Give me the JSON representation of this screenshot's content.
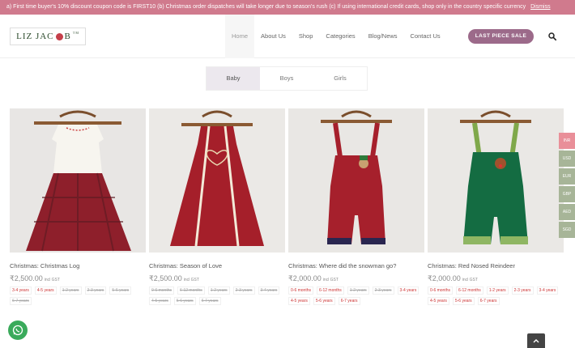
{
  "notice": {
    "text": "a) First time buyer's 10% discount coupon code is FIRST10 (b) Christmas order dispatches will take longer due to season's rush (c) If using international credit cards, shop only in the country specific currency",
    "dismiss": "Dismiss"
  },
  "logo": {
    "left": "LIZ JAC",
    "right": "B",
    "tm": "TM"
  },
  "nav": [
    "Home",
    "About Us",
    "Shop",
    "Categories",
    "Blog/News",
    "Contact Us"
  ],
  "sale_button": "LAST PIECE SALE",
  "tabs": [
    "Baby",
    "Boys",
    "Girls"
  ],
  "products": [
    {
      "title": "Christmas: Christmas Log",
      "price": "₹2,500.00",
      "gst": "incl GST",
      "sizes": [
        {
          "label": "3-4 years",
          "available": true
        },
        {
          "label": "4-5 years",
          "available": true
        },
        {
          "label": "1-2 years",
          "available": false
        },
        {
          "label": "2-3 years",
          "available": false
        },
        {
          "label": "5-6 years",
          "available": false
        },
        {
          "label": "6-7 years",
          "available": false
        }
      ]
    },
    {
      "title": "Christmas: Season of Love",
      "price": "₹2,500.00",
      "gst": "incl GST",
      "sizes": [
        {
          "label": "0-6 months",
          "available": false
        },
        {
          "label": "6-12 months",
          "available": false
        },
        {
          "label": "1-2 years",
          "available": false
        },
        {
          "label": "2-3 years",
          "available": false
        },
        {
          "label": "3-4 years",
          "available": false
        },
        {
          "label": "4-5 years",
          "available": false
        },
        {
          "label": "5-6 years",
          "available": false
        },
        {
          "label": "6-7 years",
          "available": false
        }
      ]
    },
    {
      "title": "Christmas: Where did the snowman go?",
      "price": "₹2,000.00",
      "gst": "incl GST",
      "sizes": [
        {
          "label": "0-6 months",
          "available": true
        },
        {
          "label": "6-12 months",
          "available": true
        },
        {
          "label": "1-2 years",
          "available": false
        },
        {
          "label": "2-3 years",
          "available": false
        },
        {
          "label": "3-4 years",
          "available": true
        },
        {
          "label": "4-5 years",
          "available": true
        },
        {
          "label": "5-6 years",
          "available": true
        },
        {
          "label": "6-7 years",
          "available": true
        }
      ]
    },
    {
      "title": "Christmas: Red Nosed Reindeer",
      "price": "₹2,000.00",
      "gst": "incl GST",
      "sizes": [
        {
          "label": "0-6 months",
          "available": true
        },
        {
          "label": "6-12 months",
          "available": true
        },
        {
          "label": "1-2 years",
          "available": true
        },
        {
          "label": "2-3 years",
          "available": true
        },
        {
          "label": "3-4 years",
          "available": true
        },
        {
          "label": "4-5 years",
          "available": true
        },
        {
          "label": "5-6 years",
          "available": true
        },
        {
          "label": "6-7 years",
          "available": true
        }
      ]
    }
  ],
  "currencies": [
    "INR",
    "USD",
    "EUR",
    "GBP",
    "AED",
    "SGD"
  ],
  "icons": {
    "search": "search-icon",
    "whatsapp": "whatsapp-icon",
    "scroll_top": "chevron-up-icon"
  },
  "colors": {
    "notice_bar": "#d07a8d",
    "sale_button": "#9c6a8a",
    "currency_active": "#e98f99",
    "currency": "#a7b598",
    "whatsapp": "#3aaa5b",
    "available_size": "#cc3333"
  }
}
